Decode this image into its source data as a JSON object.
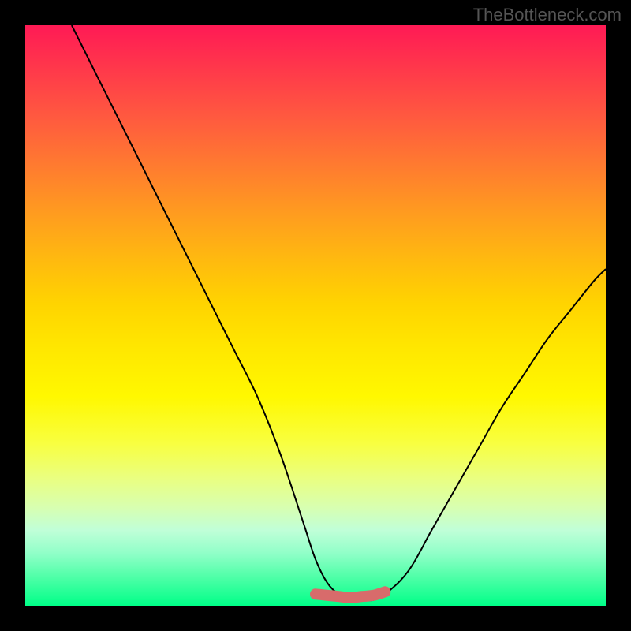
{
  "watermark": "TheBottleneck.com",
  "chart_data": {
    "type": "line",
    "title": "",
    "xlabel": "",
    "ylabel": "",
    "xlim": [
      0,
      100
    ],
    "ylim": [
      0,
      100
    ],
    "series": [
      {
        "name": "curve",
        "x": [
          8,
          12,
          16,
          20,
          24,
          28,
          32,
          36,
          40,
          44,
          48,
          50,
          52,
          54,
          56,
          58,
          60,
          62,
          66,
          70,
          74,
          78,
          82,
          86,
          90,
          94,
          98,
          100
        ],
        "values": [
          100,
          92,
          84,
          76,
          68,
          60,
          52,
          44,
          36,
          26,
          14,
          8,
          4,
          2,
          1,
          1,
          1,
          2,
          6,
          13,
          20,
          27,
          34,
          40,
          46,
          51,
          56,
          58
        ]
      },
      {
        "name": "bottom-marker",
        "x": [
          50,
          52,
          54,
          56,
          58,
          60,
          62
        ],
        "values": [
          2.0,
          1.8,
          1.6,
          1.4,
          1.6,
          1.8,
          2.4
        ]
      }
    ],
    "notes": "V-shaped curve over vertical rainbow gradient (red top to green bottom). Y-axis inverted visually: higher numerical values correspond to top (red zone), lower values to bottom (green zone). A short pink/salmon thick segment marks the flat minimum region around x=50..62."
  }
}
